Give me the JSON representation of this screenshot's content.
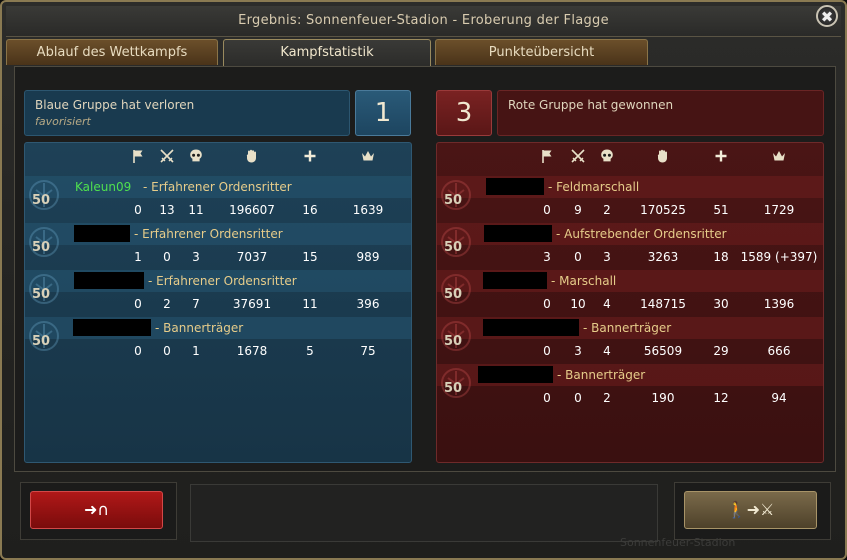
{
  "window": {
    "title": "Ergebnis: Sonnenfeuer-Stadion - Eroberung der Flagge",
    "close_label": "✖",
    "watermark": "Sonnenfeuer-Stadion"
  },
  "tabs": [
    {
      "label": "Ablauf des Wettkampfs",
      "active": false
    },
    {
      "label": "Kampfstatistik",
      "active": true
    },
    {
      "label": "Punkteübersicht",
      "active": false
    }
  ],
  "blue": {
    "result": "Blaue Gruppe hat verloren",
    "subtitle": "favorisiert",
    "score": "1",
    "players": [
      {
        "level": "50",
        "name": "Kaleun09",
        "rank": "- Erfahrener Ordensritter",
        "flags": "0",
        "kills": "13",
        "deaths": "11",
        "damage": "196607",
        "heal": "16",
        "points": "1639"
      },
      {
        "level": "50",
        "name": "",
        "rank": "- Erfahrener Ordensritter",
        "flags": "1",
        "kills": "0",
        "deaths": "3",
        "damage": "7037",
        "heal": "15",
        "points": "989"
      },
      {
        "level": "50",
        "name": "",
        "rank": "- Erfahrener Ordensritter",
        "flags": "0",
        "kills": "2",
        "deaths": "7",
        "damage": "37691",
        "heal": "11",
        "points": "396"
      },
      {
        "level": "50",
        "name": "",
        "rank": "- Bannerträger",
        "flags": "0",
        "kills": "0",
        "deaths": "1",
        "damage": "1678",
        "heal": "5",
        "points": "75"
      }
    ]
  },
  "red": {
    "result": "Rote Gruppe hat gewonnen",
    "score": "3",
    "players": [
      {
        "level": "50",
        "rank": "- Feldmarschall",
        "flags": "0",
        "kills": "9",
        "deaths": "2",
        "damage": "170525",
        "heal": "51",
        "points": "1729"
      },
      {
        "level": "50",
        "rank": "- Aufstrebender Ordensritter",
        "flags": "3",
        "kills": "0",
        "deaths": "3",
        "damage": "3263",
        "heal": "18",
        "points": "1589 (+397)"
      },
      {
        "level": "50",
        "rank": "- Marschall",
        "flags": "0",
        "kills": "10",
        "deaths": "4",
        "damage": "148715",
        "heal": "30",
        "points": "1396"
      },
      {
        "level": "50",
        "rank": "- Bannerträger",
        "flags": "0",
        "kills": "3",
        "deaths": "4",
        "damage": "56509",
        "heal": "29",
        "points": "666"
      },
      {
        "level": "50",
        "rank": "- Bannerträger",
        "flags": "0",
        "kills": "0",
        "deaths": "2",
        "damage": "190",
        "heal": "12",
        "points": "94"
      }
    ]
  },
  "columns": [
    "flag-icon",
    "crossed-swords-icon",
    "skull-icon",
    "fist-icon",
    "plus-icon",
    "crown-icon"
  ],
  "colors": {
    "blue_panel": "#1e4157",
    "red_panel": "#4a1515",
    "player_highlight": "#4fe04f",
    "rank_text": "#e6cc8a"
  },
  "buttons": {
    "leave_label": "➜∩",
    "join_label": "🚶➜⚔"
  }
}
